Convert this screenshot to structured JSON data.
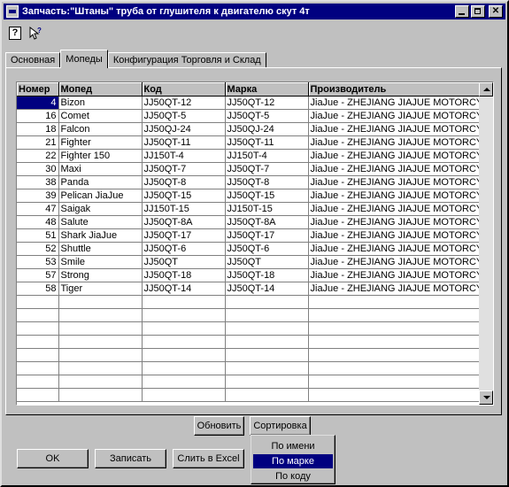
{
  "window": {
    "title": "Запчасть:\"Штаны\" труба от глушителя к двигателю скут 4т"
  },
  "toolbar": {
    "help_icon": "question-mark-icon",
    "whats_this_icon": "pointer-help-icon",
    "help_label": "?"
  },
  "tabs": [
    {
      "label": "Основная",
      "active": false
    },
    {
      "label": "Мопеды",
      "active": true
    },
    {
      "label": "Конфигурация Торговля и Склад",
      "active": false
    }
  ],
  "table": {
    "columns": [
      "Номер",
      "Мопед",
      "Код",
      "Марка",
      "Производитель"
    ],
    "rows": [
      [
        "4",
        "Bizon",
        "JJ50QT-12",
        "JJ50QT-12",
        "JiaJue - ZHEJIANG JIAJUE MOTORCYCLE"
      ],
      [
        "16",
        "Comet",
        "JJ50QT-5",
        "JJ50QT-5",
        "JiaJue - ZHEJIANG JIAJUE MOTORCYCLE"
      ],
      [
        "18",
        "Falcon",
        "JJ50QJ-24",
        "JJ50QJ-24",
        "JiaJue - ZHEJIANG JIAJUE MOTORCYCLE"
      ],
      [
        "21",
        "Fighter",
        "JJ50QT-11",
        "JJ50QT-11",
        "JiaJue - ZHEJIANG JIAJUE MOTORCYCLE"
      ],
      [
        "22",
        "Fighter 150",
        "JJ150T-4",
        "JJ150T-4",
        "JiaJue - ZHEJIANG JIAJUE MOTORCYCLE"
      ],
      [
        "30",
        "Maxi",
        "JJ50QT-7",
        "JJ50QT-7",
        "JiaJue - ZHEJIANG JIAJUE MOTORCYCLE"
      ],
      [
        "38",
        "Panda",
        "JJ50QT-8",
        "JJ50QT-8",
        "JiaJue - ZHEJIANG JIAJUE MOTORCYCLE"
      ],
      [
        "39",
        "Pelican JiaJue",
        "JJ50QT-15",
        "JJ50QT-15",
        "JiaJue - ZHEJIANG JIAJUE MOTORCYCLE"
      ],
      [
        "47",
        "Saigak",
        "JJ150T-15",
        "JJ150T-15",
        "JiaJue - ZHEJIANG JIAJUE MOTORCYCLE"
      ],
      [
        "48",
        "Salute",
        "JJ50QT-8A",
        "JJ50QT-8A",
        "JiaJue - ZHEJIANG JIAJUE MOTORCYCLE"
      ],
      [
        "51",
        "Shark JiaJue",
        "JJ50QT-17",
        "JJ50QT-17",
        "JiaJue - ZHEJIANG JIAJUE MOTORCYCLE"
      ],
      [
        "52",
        "Shuttle",
        "JJ50QT-6",
        "JJ50QT-6",
        "JiaJue - ZHEJIANG JIAJUE MOTORCYCLE"
      ],
      [
        "53",
        "Smile",
        "JJ50QT",
        "JJ50QT",
        "JiaJue - ZHEJIANG JIAJUE MOTORCYCLE"
      ],
      [
        "57",
        "Strong",
        "JJ50QT-18",
        "JJ50QT-18",
        "JiaJue - ZHEJIANG JIAJUE MOTORCYCLE"
      ],
      [
        "58",
        "Tiger",
        "JJ50QT-14",
        "JJ50QT-14",
        "JiaJue - ZHEJIANG JIAJUE MOTORCYCLE"
      ]
    ],
    "selected_row": 0
  },
  "buttons": {
    "refresh": "Обновить",
    "sort": "Сортировка",
    "ok": "OK",
    "save": "Записать",
    "excel": "Слить в Excel"
  },
  "sort_menu": {
    "items": [
      "По имени",
      "По марке",
      "По коду"
    ],
    "highlighted": 1
  },
  "colors": {
    "titlebar": "#000080",
    "selection": "#000080",
    "face": "#c0c0c0"
  }
}
